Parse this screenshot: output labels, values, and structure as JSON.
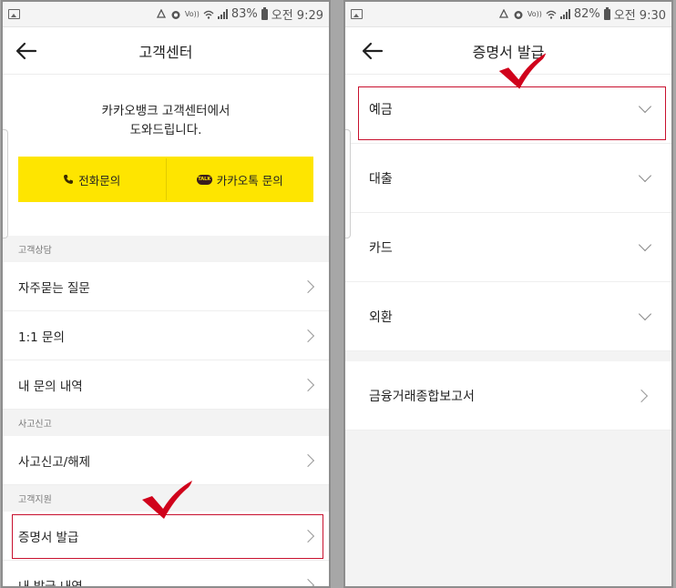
{
  "left": {
    "status": {
      "battery": "83%",
      "time": "오전 9:29"
    },
    "title": "고객센터",
    "intro_line1": "카카오뱅크 고객센터에서",
    "intro_line2": "도와드립니다.",
    "phone_button": "전화문의",
    "kakao_button": "카카오톡 문의",
    "talk_badge": "TALK",
    "sections": {
      "consult": "고객상담",
      "report": "사고신고",
      "support": "고객지원"
    },
    "items": {
      "faq": "자주묻는 질문",
      "one_to_one": "1:1 문의",
      "my_inquiries": "내 문의 내역",
      "accident": "사고신고/해제",
      "certificate": "증명서 발급",
      "my_issued": "내 발급 내역"
    }
  },
  "right": {
    "status": {
      "battery": "82%",
      "time": "오전 9:30"
    },
    "title": "증명서 발급",
    "items": {
      "deposit": "예금",
      "loan": "대출",
      "card": "카드",
      "forex": "외환",
      "report": "금융거래종합보고서"
    }
  },
  "colors": {
    "kakao_yellow": "#fee500",
    "highlight_red": "#c8102e",
    "check_red": "#d0021b"
  }
}
